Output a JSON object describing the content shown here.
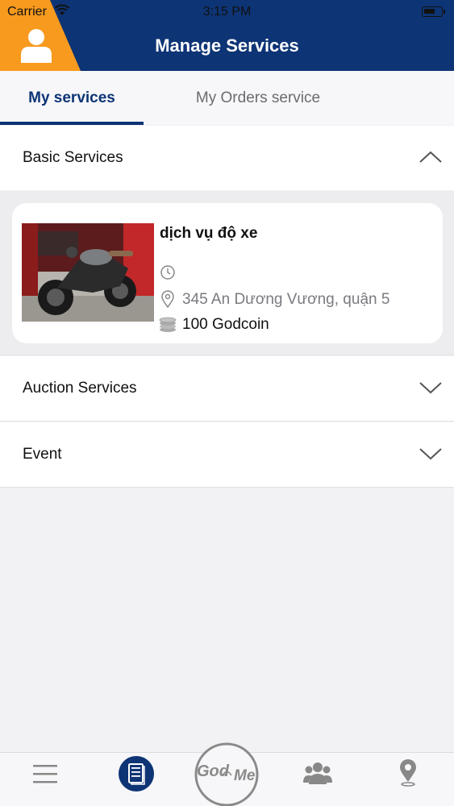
{
  "status_bar": {
    "carrier": "Carrier",
    "time": "3:15 PM"
  },
  "header": {
    "title": "Manage Services",
    "avatar_icon": "user-icon"
  },
  "tabs": [
    {
      "label": "My services",
      "active": true
    },
    {
      "label": "My Orders service",
      "active": false
    }
  ],
  "sections": {
    "basic": {
      "title": "Basic Services",
      "expanded": true
    },
    "auction": {
      "title": "Auction Services",
      "expanded": false
    },
    "event": {
      "title": "Event",
      "expanded": false
    }
  },
  "service_card": {
    "title": "dịch vụ độ xe",
    "address": "345 An Dương Vương, quận 5",
    "price": "100 Godcoin"
  },
  "bottom_nav": {
    "items": [
      "menu-icon",
      "document-icon",
      "godme-logo",
      "group-icon",
      "location-pin-icon"
    ],
    "logo_text_left": "God",
    "logo_text_right": "Me",
    "active": "document-icon"
  },
  "colors": {
    "primary": "#0d3475",
    "accent": "#f79a1e",
    "background": "#f2f2f4"
  }
}
